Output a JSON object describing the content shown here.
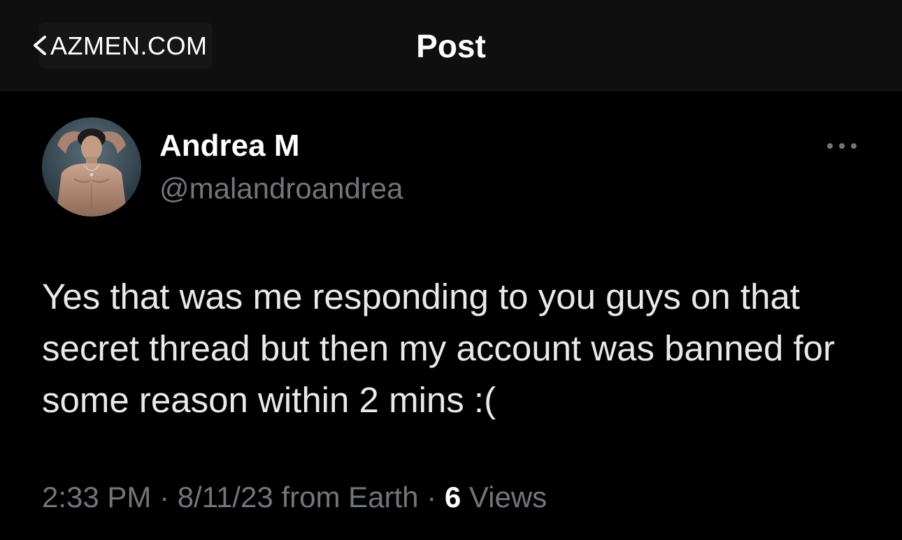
{
  "header": {
    "back_label": "AZMEN.COM",
    "title": "Post"
  },
  "post": {
    "author": {
      "display_name": "Andrea M",
      "handle": "@malandroandrea"
    },
    "text": "Yes that was me responding to you guys on that secret thread but then my account was banned for some reason within 2 mins :(",
    "meta": {
      "time": "2:33 PM",
      "date": "8/11/23",
      "source": "from Earth",
      "separator": "·",
      "views_count": "6",
      "views_label": "Views"
    }
  },
  "icons": {
    "back": "chevron-left-icon",
    "more": "more-horizontal-icon"
  },
  "colors": {
    "background": "#000000",
    "header_background": "#0f0f0f",
    "primary_text": "#e7e9ea",
    "secondary_text": "#71767b"
  }
}
